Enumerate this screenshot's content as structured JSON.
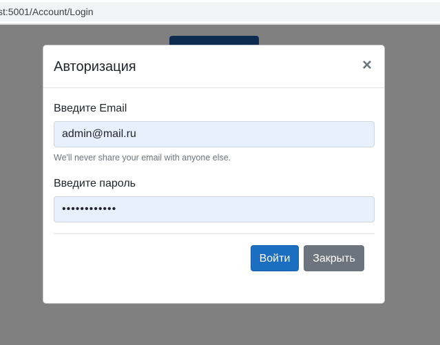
{
  "browser": {
    "address": "st:5001/Account/Login"
  },
  "modal": {
    "title": "Авторизация",
    "close_glyph": "×",
    "email": {
      "label": "Введите Email",
      "value": "admin@mail.ru",
      "help": "We'll never share your email with anyone else."
    },
    "password": {
      "label": "Введите пароль",
      "masked_value": "••••••••••••"
    },
    "buttons": {
      "login": "Войти",
      "close": "Закрыть"
    }
  },
  "colors": {
    "backdrop": "#808080",
    "primary": "#1b6ec2",
    "secondary": "#6c757d",
    "autofill": "#e8f0fe"
  },
  "icons": {
    "close": "close-icon"
  }
}
